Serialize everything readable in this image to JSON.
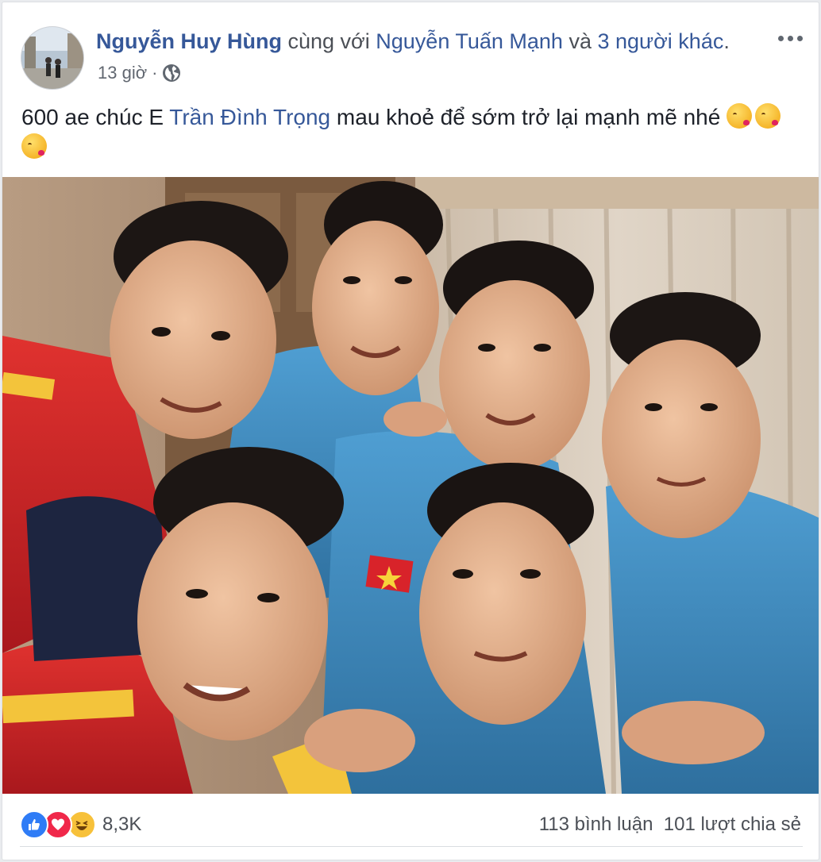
{
  "post": {
    "author": "Nguyễn Huy Hùng",
    "with_text": " cùng với ",
    "tagged": "Nguyễn Tuấn Mạnh",
    "and_text": " và ",
    "others": "3 người khác",
    "period": ".",
    "time": "13 giờ",
    "separator": "·",
    "privacy_icon": "globe-icon",
    "more_icon": "more-options-icon",
    "text_before": "600 ae chúc E ",
    "mention": "Trần Đình Trọng",
    "text_after": " mau khoẻ để sớm trở lại mạnh mẽ nhé ",
    "emojis": [
      "kissing-heart-emoji",
      "kissing-heart-emoji",
      "kissing-heart-emoji"
    ]
  },
  "photo": {
    "subject": "group-selfie"
  },
  "footer": {
    "reaction_icons": [
      "like-icon",
      "love-icon",
      "haha-icon"
    ],
    "reaction_count": "8,3K",
    "comments": "113 bình luận",
    "shares": "101 lượt chia sẻ"
  },
  "colors": {
    "link": "#365899",
    "like": "#2f7cf6",
    "love": "#f0284a",
    "haha": "#f7c13a",
    "jersey_red": "#d8232a",
    "jersey_blue": "#3d8fc6"
  }
}
